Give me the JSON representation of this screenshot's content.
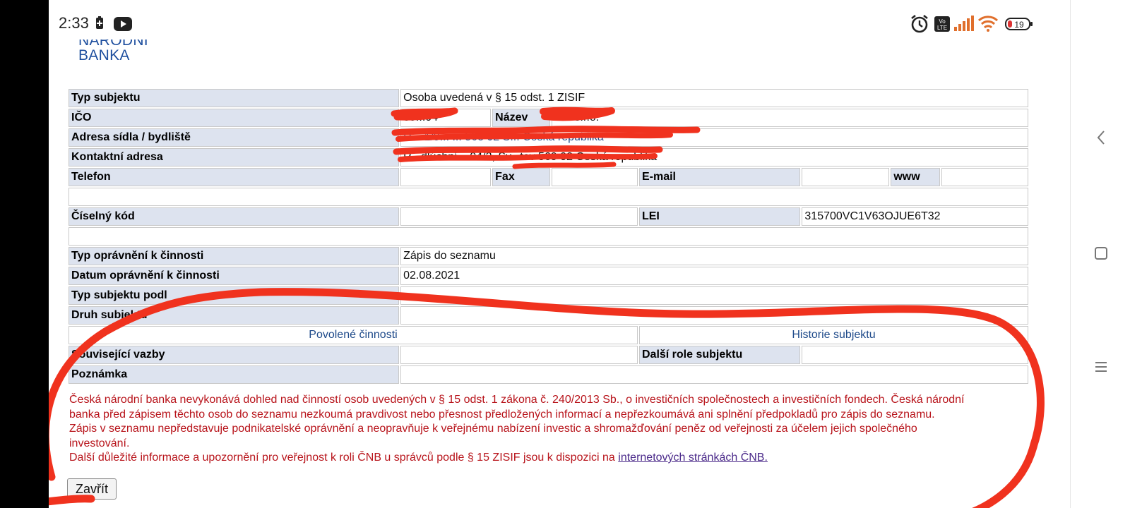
{
  "status_bar": {
    "time": "2:33",
    "battery": "19"
  },
  "logo": {
    "line1": "NÁRODNÍ",
    "line2": "BANKA"
  },
  "table": {
    "typ_subjektu_label": "Typ subjektu",
    "typ_subjektu_value": "Osoba uvedená v § 15 odst. 1 ZISIF",
    "ico_label": "IČO",
    "ico_value": "09...04",
    "nazev_label": "Název",
    "nazev_value": "A... s.r.o.",
    "adresa_label": "Adresa sídla / bydliště",
    "adresa_value": "R... 1/9... ... 568 02 S... Česká republika",
    "kontaktni_label": "Kontaktní adresa",
    "kontaktni_value": "R...dlúchní ...94/2, Sv...tov 569 02 Česká republika",
    "telefon_label": "Telefon",
    "fax_label": "Fax",
    "email_label": "E-mail",
    "www_label": "www",
    "ciselny_label": "Číselný kód",
    "lei_label": "LEI",
    "lei_value": "315700VC1V63OJUE6T32",
    "typ_opravneni_label": "Typ oprávnění k činnosti",
    "typ_opravneni_value": "Zápis do seznamu",
    "datum_label": "Datum oprávnění k činnosti",
    "datum_value": "02.08.2021",
    "typ_subjektu_podle_label": "Typ subjektu podl",
    "druh_label": "Druh subjektu",
    "povolene_link": "Povolené činnosti",
    "historie_link": "Historie subjektu",
    "souvisejici_label": "Související vazby",
    "dalsi_role_label": "Další role subjektu",
    "poznamka_label": "Poznámka"
  },
  "notice": {
    "line1": "Česká národní banka nevykonává dohled nad činností osob uvedených v § 15 odst. 1 zákona č. 240/2013 Sb., o investičních společnostech a investičních fondech. Česká národní",
    "line2": "banka před zápisem těchto osob do seznamu nezkoumá pravdivost nebo přesnost předložených informací a nepřezkoumává ani splnění předpokladů pro zápis do seznamu.",
    "line3": "Zápis v seznamu nepředstavuje podnikatelské oprávnění a neopravňuje k veřejnému nabízení investic a shromažďování peněz od veřejnosti za účelem jejich společného",
    "line4": "investování.",
    "line5_prefix": "Další důležité informace a upozornění pro veřejnost k roli ČNB u správců podle § 15 ZISIF jsou k dispozici na ",
    "line5_link": "internetových stránkách ČNB."
  },
  "buttons": {
    "close": "Zavřít"
  },
  "colors": {
    "label_bg": "#dde3ef",
    "link": "#1e4a8a",
    "notice_text": "#b8141b",
    "annotation": "#f0321e"
  },
  "icons": [
    "battery-saver-icon",
    "youtube-icon",
    "alarm-icon",
    "volte-icon",
    "signal-icon",
    "wifi-icon",
    "battery-icon",
    "back-icon",
    "recents-icon",
    "menu-icon"
  ]
}
